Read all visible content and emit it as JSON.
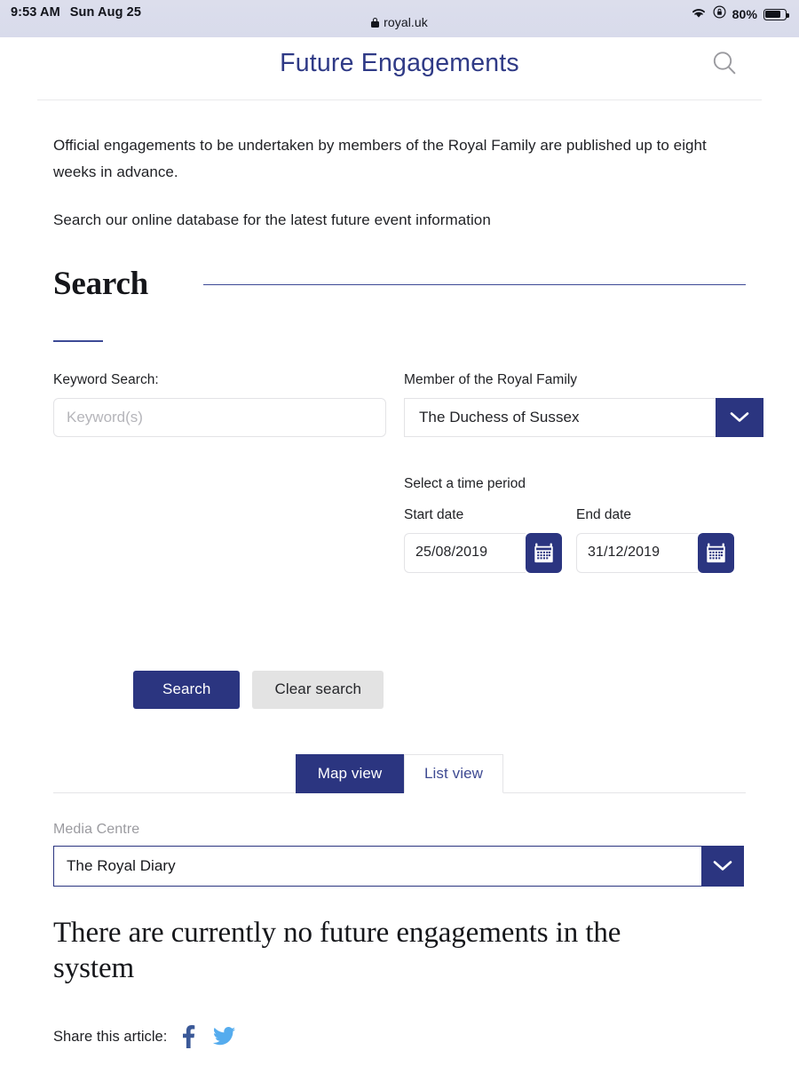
{
  "statusbar": {
    "time": "9:53 AM",
    "date": "Sun Aug 25",
    "battery_percent": "80%",
    "wifi_icon": "wifi-icon",
    "rotation_lock_icon": "rotation-lock-icon",
    "battery_icon": "battery-icon"
  },
  "browser": {
    "url": "royal.uk",
    "lock_icon": "lock-icon"
  },
  "header": {
    "title": "Future Engagements",
    "search_icon": "search-icon"
  },
  "intro": {
    "paragraph_1": "Official engagements to be undertaken by members of the Royal Family are published up to eight weeks in advance.",
    "paragraph_2": "Search our online database for the latest future event information"
  },
  "search_section": {
    "heading": "Search",
    "keyword": {
      "label": "Keyword Search:",
      "placeholder": "Keyword(s)",
      "value": ""
    },
    "member": {
      "label": "Member of the Royal Family",
      "value": "The Duchess of Sussex",
      "chevron_icon": "chevron-down-icon"
    },
    "time_period": {
      "title": "Select a time period",
      "start": {
        "label": "Start date",
        "value": "25/08/2019",
        "calendar_icon": "calendar-icon"
      },
      "end": {
        "label": "End date",
        "value": "31/12/2019",
        "calendar_icon": "calendar-icon"
      }
    },
    "buttons": {
      "search": "Search",
      "clear": "Clear search"
    }
  },
  "tabs": {
    "map_view": "Map view",
    "list_view": "List view",
    "active": "Map view"
  },
  "media_centre": {
    "label": "Media Centre",
    "value": "The Royal Diary",
    "chevron_icon": "chevron-down-icon"
  },
  "results": {
    "empty_message": "There are currently no future engagements in the system"
  },
  "share": {
    "label": "Share this article:",
    "facebook_icon": "facebook-icon",
    "twitter_icon": "twitter-icon"
  },
  "colors": {
    "navy": "#2b3580",
    "title_navy": "#2f3a86",
    "facebook": "#3b5998",
    "twitter": "#55acee",
    "secondary_button": "#e3e3e3"
  }
}
